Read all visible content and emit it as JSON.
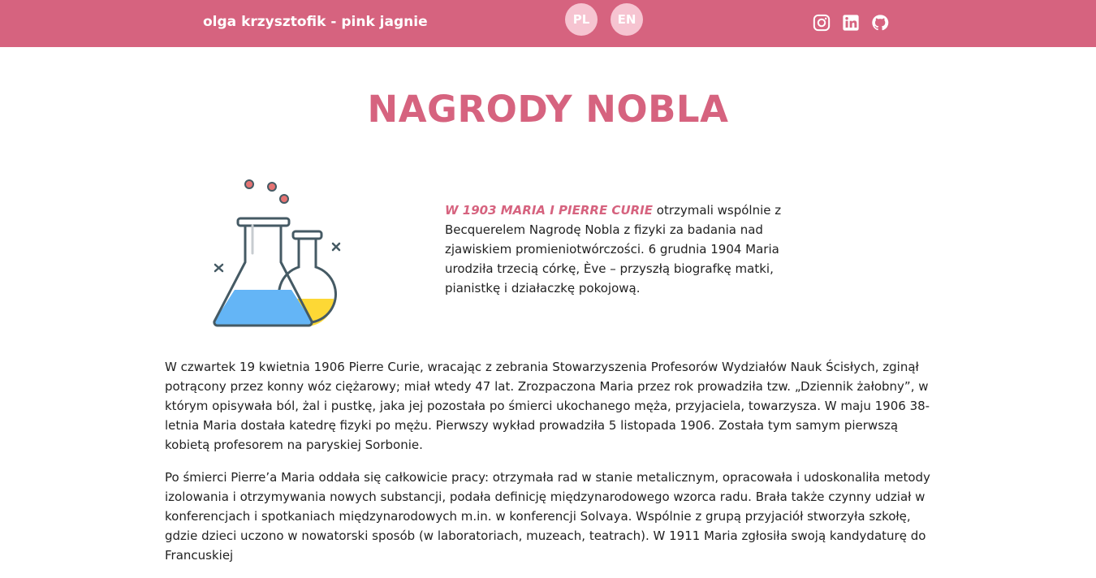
{
  "header": {
    "brand": "olga krzysztofik - pink jagnie",
    "languages": [
      "PL",
      "EN"
    ],
    "social": [
      "instagram-icon",
      "linkedin-icon",
      "github-icon"
    ]
  },
  "colors": {
    "accent": "#d6637f",
    "lang_bg": "#f6c4d1",
    "liquid_blue": "#64b5f6",
    "liquid_yellow": "#fdd835"
  },
  "main": {
    "title": "NAGRODY NOBLA",
    "illustration": "chemistry-flasks-icon",
    "intro_lead": "W 1903 MARIA I PIERRE CURIE",
    "intro_text": " otrzymali wspólnie z Becquerelem Nagrodę Nobla z fizyki za badania nad zjawiskiem promieniotwórczości. 6 grudnia 1904 Maria urodziła trzecią córkę, Ève – przyszłą biografkę matki, pianistkę i działaczkę pokojową.",
    "paragraphs": [
      "W czwartek 19 kwietnia 1906 Pierre Curie, wracając z zebrania Stowarzyszenia Profesorów Wydziałów Nauk Ścisłych, zginął potrącony przez konny wóz ciężarowy; miał wtedy 47 lat. Zrozpaczona Maria przez rok prowadziła tzw. „Dziennik żałobny”, w którym opisywała ból, żal i pustkę, jaka jej pozostała po śmierci ukochanego męża, przyjaciela, towarzysza. W maju 1906 38-letnia Maria dostała katedrę fizyki po mężu. Pierwszy wykład prowadziła 5 listopada 1906. Została tym samym pierwszą kobietą profesorem na paryskiej Sorbonie.",
      "Po śmierci Pierre’a Maria oddała się całkowicie pracy: otrzymała rad w stanie metalicznym, opracowała i udoskonaliła metody izolowania i otrzymywania nowych substancji, podała definicję międzynarodowego wzorca radu. Brała także czynny udział w konferencjach i spotkaniach międzynarodowych m.in. w konferencji Solvaya. Wspólnie z grupą przyjaciół stworzyła szkołę, gdzie dzieci uczono w nowatorski sposób (w laboratoriach, muzeach, teatrach). W 1911 Maria zgłosiła swoją kandydaturę do Francuskiej"
    ]
  }
}
